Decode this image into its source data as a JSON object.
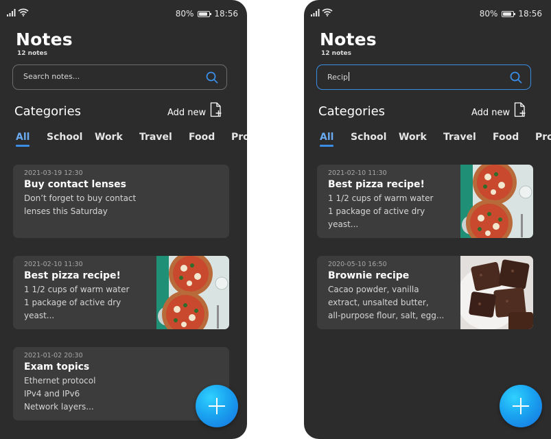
{
  "screens": [
    {
      "status": {
        "battery_percent_label": "80%",
        "battery_level": 0.8,
        "time": "18:56"
      },
      "header": {
        "title": "Notes",
        "note_count": "12 notes"
      },
      "search": {
        "placeholder": "Search notes...",
        "value": "",
        "active": false
      },
      "categories": {
        "heading": "Categories",
        "add_new_label": "Add new",
        "tabs": [
          "All",
          "School",
          "Work",
          "Travel",
          "Food",
          "Pro"
        ],
        "active_tab": "All"
      },
      "notes": [
        {
          "date": "2021-03-19 12:30",
          "title": "Buy contact lenses",
          "lines": [
            "Don’t forget to buy contact",
            "lenses this Saturday"
          ],
          "image": "none"
        },
        {
          "date": "2021-02-10 11:30",
          "title": "Best pizza recipe!",
          "lines": [
            "1 1/2 cups of warm water",
            "1 package of active dry",
            "yeast..."
          ],
          "image": "pizza-photo"
        },
        {
          "date": "2021-01-02 20:30",
          "title": "Exam topics",
          "lines": [
            "Ethernet protocol",
            "IPv4 and IPv6",
            "Network layers..."
          ],
          "image": "none"
        }
      ],
      "fab_icon": "plus-icon"
    },
    {
      "status": {
        "battery_percent_label": "80%",
        "battery_level": 0.8,
        "time": "18:56"
      },
      "header": {
        "title": "Notes",
        "note_count": "12 notes"
      },
      "search": {
        "placeholder": "Search notes...",
        "value": "Recip",
        "active": true
      },
      "categories": {
        "heading": "Categories",
        "add_new_label": "Add new",
        "tabs": [
          "All",
          "School",
          "Work",
          "Travel",
          "Food",
          "Pro"
        ],
        "active_tab": "All"
      },
      "notes": [
        {
          "date": "2021-02-10 11:30",
          "title": "Best pizza recipe!",
          "lines": [
            "1 1/2 cups of warm water",
            "1 package of active dry",
            "yeast..."
          ],
          "image": "pizza-photo"
        },
        {
          "date": "2020-05-10 16:50",
          "title": "Brownie recipe",
          "lines": [
            "Cacao powder, vanilla",
            "extract, unsalted butter,",
            "all-purpose flour, salt, egg..."
          ],
          "image": "brownie-photo"
        }
      ],
      "fab_icon": "plus-icon"
    }
  ],
  "colors": {
    "background": "#2c2c2c",
    "card": "#3c3c3c",
    "accent": "#3a8ee6",
    "fab": "#1aa3f0"
  }
}
